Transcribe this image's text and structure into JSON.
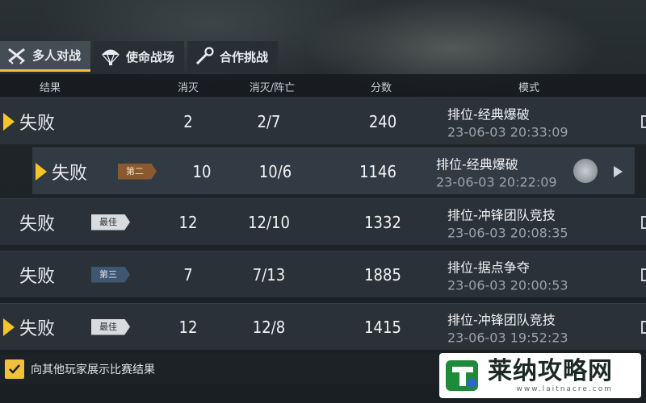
{
  "tabs": [
    {
      "label": "多人对战",
      "icon": "crossed-guns-icon",
      "active": true
    },
    {
      "label": "使命战场",
      "icon": "parachute-icon",
      "active": false
    },
    {
      "label": "合作挑战",
      "icon": "wrench-icon",
      "active": false
    }
  ],
  "columns": {
    "result": "结果",
    "kills": "消灭",
    "kd": "消灭/阵亡",
    "score": "分数",
    "mode": "模式"
  },
  "rows": [
    {
      "result": "失败",
      "badge": "",
      "kills": "2",
      "kd": "2/7",
      "score": "240",
      "mode": "排位-经典爆破",
      "time": "23-06-03 20:33:09"
    },
    {
      "result": "失败",
      "badge": "第二",
      "kills": "10",
      "kd": "10/6",
      "score": "1146",
      "mode": "排位-经典爆破",
      "time": "23-06-03 20:22:09"
    },
    {
      "result": "失败",
      "badge": "最佳",
      "kills": "12",
      "kd": "12/10",
      "score": "1332",
      "mode": "排位-冲锋团队竞技",
      "time": "23-06-03 20:08:35"
    },
    {
      "result": "失败",
      "badge": "第三",
      "kills": "7",
      "kd": "7/13",
      "score": "1885",
      "mode": "排位-据点争夺",
      "time": "23-06-03 20:00:53"
    },
    {
      "result": "失败",
      "badge": "最佳",
      "kills": "12",
      "kd": "12/8",
      "score": "1415",
      "mode": "排位-冲锋团队竞技",
      "time": "23-06-03 19:52:23"
    }
  ],
  "footer": {
    "checkbox_label": "向其他玩家展示比赛结果",
    "checked": true
  },
  "watermark": {
    "title": "莱纳攻略网",
    "url": "www.laitnacre.com"
  },
  "colors": {
    "accent": "#f0c23a",
    "best_badge": "#d9dcde",
    "second_badge": "#8a5a2e",
    "third_badge": "#3f5670"
  }
}
